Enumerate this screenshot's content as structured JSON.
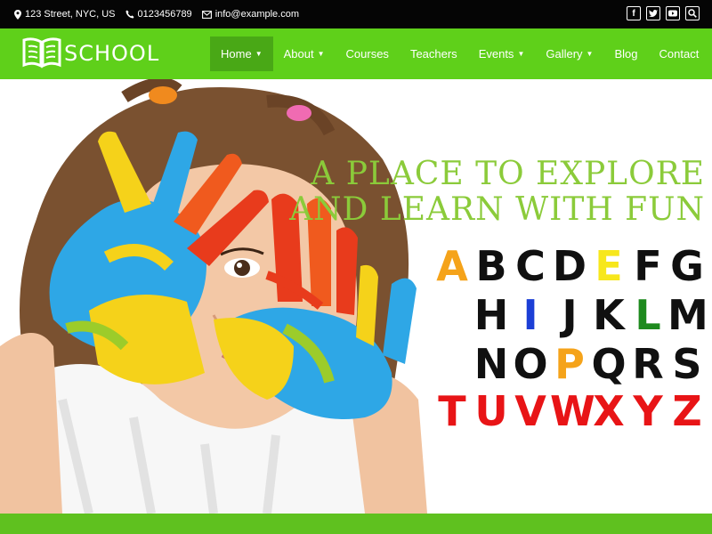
{
  "topbar": {
    "address": "123 Street, NYC, US",
    "phone": "0123456789",
    "email": "info@example.com"
  },
  "brand": {
    "name": "SCHOOL"
  },
  "nav": {
    "items": [
      {
        "label": "Home",
        "dropdown": true,
        "active": true
      },
      {
        "label": "About",
        "dropdown": true
      },
      {
        "label": "Courses",
        "dropdown": false
      },
      {
        "label": "Teachers",
        "dropdown": false
      },
      {
        "label": "Events",
        "dropdown": true
      },
      {
        "label": "Gallery",
        "dropdown": true
      },
      {
        "label": "Blog",
        "dropdown": false
      },
      {
        "label": "Contact",
        "dropdown": false
      }
    ]
  },
  "hero": {
    "title_line1": "A PLACE TO EXPLORE",
    "title_line2": "AND LEARN WITH FUN",
    "alphabet_rows": [
      [
        "A",
        "B",
        "C",
        "D",
        "E",
        "F",
        "G"
      ],
      [
        "H",
        "I",
        "J",
        "K",
        "L",
        "M"
      ],
      [
        "N",
        "O",
        "P",
        "Q",
        "R",
        "S"
      ],
      [
        "T",
        "U",
        "V",
        "W",
        "X",
        "Y",
        "Z"
      ]
    ],
    "letter_colors": {
      "A": "#f5a31a",
      "E": "#f7e71c",
      "I": "#1c3fd6",
      "L": "#1e8a1e",
      "P": "#f5a31a",
      "default": "#101010",
      "last_row": "#e81416"
    }
  },
  "colors": {
    "topbar": "#050505",
    "nav": "#5fd01a",
    "nav_active": "#49a816",
    "hero_title": "#8bcb3a",
    "bottom_strip": "#5fc11f"
  }
}
